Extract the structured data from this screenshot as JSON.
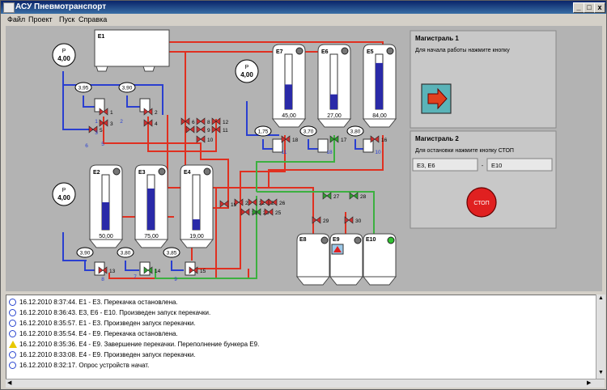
{
  "window": {
    "title": "АСУ Пневмотранспорт",
    "btn_min": "_",
    "btn_max": "□",
    "btn_close": "x"
  },
  "menu": [
    "Файл",
    "Проект",
    "Пуск",
    "Справка"
  ],
  "pressure": [
    {
      "label": "P",
      "value": "4,00"
    },
    {
      "label": "P",
      "value": "4,00"
    },
    {
      "label": "P",
      "value": "4,00"
    }
  ],
  "bunkers": [
    {
      "name": "E1"
    },
    {
      "name": "E7",
      "value": "45,00",
      "level": 0.45
    },
    {
      "name": "E6",
      "value": "27,00",
      "level": 0.27
    },
    {
      "name": "E5",
      "value": "84,00",
      "level": 0.84
    },
    {
      "name": "E2",
      "value": "50,00",
      "level": 0.5
    },
    {
      "name": "E3",
      "value": "75,00",
      "level": 0.75
    },
    {
      "name": "E4",
      "value": "19,00",
      "level": 0.19
    }
  ],
  "receivers": [
    "E8",
    "E9",
    "E10"
  ],
  "gauges": [
    "3,95",
    "3,90",
    "1,75",
    "3,70",
    "3,80",
    "3,90",
    "3,80",
    "3,85"
  ],
  "valves": [
    "1",
    "2",
    "3",
    "4",
    "5",
    "6",
    "7",
    "8",
    "9",
    "10",
    "11",
    "12",
    "13",
    "14",
    "15",
    "16",
    "17",
    "18",
    "19",
    "20",
    "21",
    "22",
    "23",
    "24",
    "25",
    "26",
    "27",
    "28",
    "29",
    "30"
  ],
  "line_tags": [
    "1",
    "2",
    "3",
    "5",
    "6",
    "7",
    "8",
    "9",
    "10",
    "11",
    "18"
  ],
  "panel1": {
    "title": "Магистраль 1",
    "text": "Для начала работы нажмите кнопку"
  },
  "panel2": {
    "title": "Магистраль 2",
    "text": "Для остановки нажмите кнопку СТОП",
    "from": "E3, E6",
    "dash": "-",
    "to": "E10",
    "stop_label": "СТОП"
  },
  "log": [
    {
      "kind": "info",
      "text": "16.12.2010 8:37:44. E1 - E3. Перекачка остановлена."
    },
    {
      "kind": "info",
      "text": "16.12.2010 8:36:43. E3, E6 - E10. Произведен запуск перекачки."
    },
    {
      "kind": "info",
      "text": "16.12.2010 8:35:57. E1 - E3. Произведен запуск перекачки."
    },
    {
      "kind": "info",
      "text": "16.12.2010 8:35:54. E4 - E9. Перекачка остановлена."
    },
    {
      "kind": "warn",
      "text": "16.12.2010 8:35:36. E4 - E9. Завершение перекачки. Переполнение бункера E9."
    },
    {
      "kind": "info",
      "text": "16.12.2010 8:33:08. E4 - E9. Произведен запуск перекачки."
    },
    {
      "kind": "info",
      "text": "16.12.2010 8:32:17. Опрос устройств начат."
    }
  ],
  "colors": {
    "air_line": "#2a3fd0",
    "active_line": "#e03020",
    "green_line": "#3cb040",
    "level": "#2a2aa8",
    "valve_red": "#d03030",
    "valve_green": "#30a030",
    "stop": "#e02020",
    "start": "#e0401e"
  }
}
